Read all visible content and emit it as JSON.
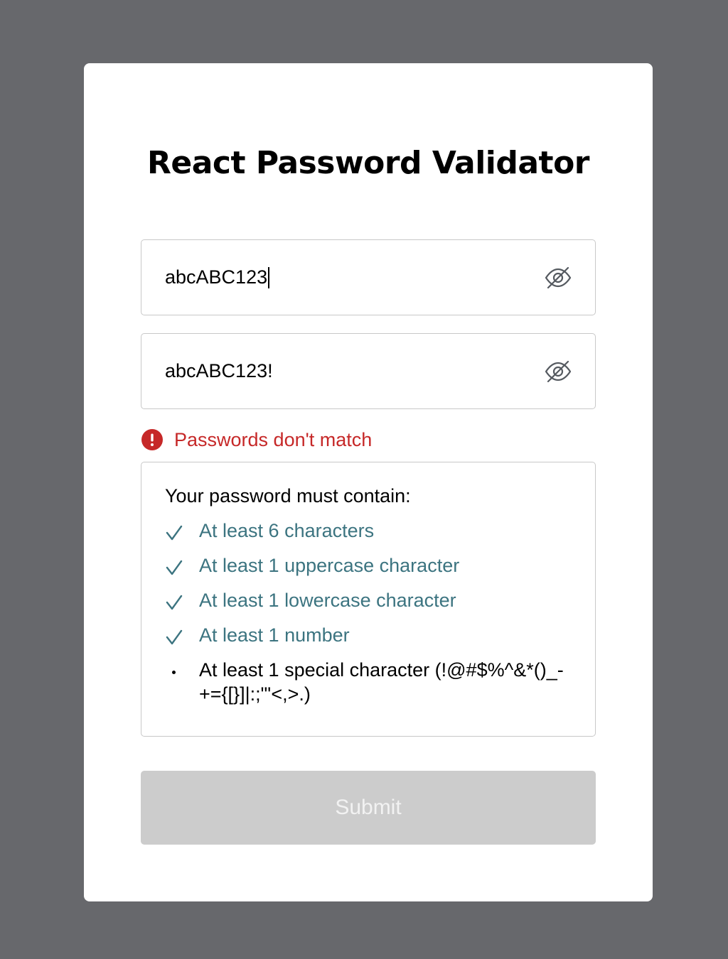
{
  "page": {
    "title": "React Password Validator"
  },
  "form": {
    "password_value": "abcABC123",
    "confirm_value": "abcABC123!",
    "toggle_icon": "eye-off-icon",
    "error_message": "Passwords don't match",
    "error_icon": "alert-circle-icon",
    "error_color": "#c62828",
    "submit_label": "Submit",
    "submit_disabled": true
  },
  "requirements": {
    "heading": "Your password must contain:",
    "items": [
      {
        "label": "At least 6 characters",
        "met": true
      },
      {
        "label": "At least 1 uppercase character",
        "met": true
      },
      {
        "label": "At least 1 lowercase character",
        "met": true
      },
      {
        "label": "At least 1 number",
        "met": true
      },
      {
        "label": "At least 1 special character (!@#$%^&*()_-+={[}]|:;\"'<,>.)",
        "met": false
      }
    ],
    "met_color": "#3c7480"
  }
}
